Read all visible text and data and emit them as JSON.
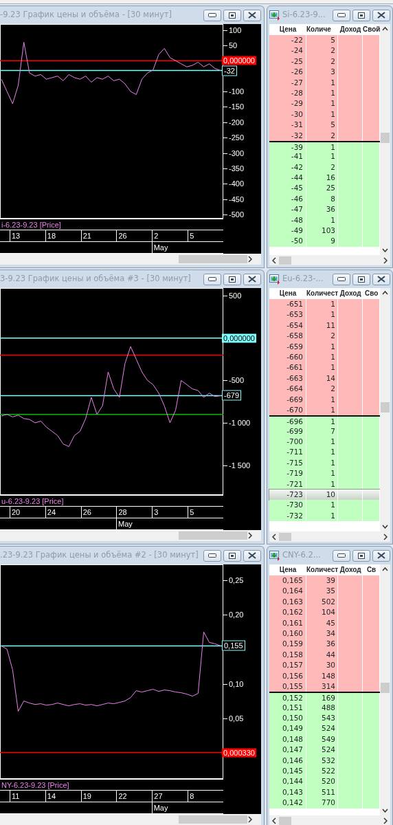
{
  "rows": [
    {
      "chart": {
        "title": "-9.23 График цены и объёма - [30 минут]",
        "chart_data": {
          "type": "line",
          "ylim": [
            -513,
            119
          ],
          "yticks": [
            {
              "value": 100,
              "label": "100"
            },
            {
              "value": 50,
              "label": "50"
            },
            {
              "value": -100,
              "label": "-100"
            },
            {
              "value": -150,
              "label": "-150"
            },
            {
              "value": -200,
              "label": "-200"
            },
            {
              "value": -250,
              "label": "-250"
            },
            {
              "value": -300,
              "label": "-300"
            },
            {
              "value": -350,
              "label": "-350"
            },
            {
              "value": -400,
              "label": "-400"
            },
            {
              "value": -450,
              "label": "-450"
            },
            {
              "value": -500,
              "label": "-500"
            }
          ],
          "series": [
            {
              "name": "i-6.23-9.23 [Price]",
              "color": "#ee82ee",
              "values": [
                -60,
                -100,
                -140,
                -80,
                60,
                -40,
                -50,
                -45,
                -60,
                -55,
                -50,
                -65,
                -45,
                -55,
                -60,
                -50,
                -70,
                -55,
                -60,
                -50,
                -65,
                -60,
                -75,
                -100,
                -110,
                -60,
                -40,
                -30,
                20,
                40,
                10,
                0,
                -10,
                -20,
                -15,
                -5,
                -20,
                -10,
                -25,
                -32
              ]
            }
          ],
          "ref_lines": [
            {
              "axis": "y",
              "value": 0,
              "label": "0,000000",
              "color": "#ff0000"
            },
            {
              "axis": "y",
              "value": -32,
              "label": "-32",
              "color": "#80ffff"
            }
          ]
        },
        "dates": [
          {
            "label": "13"
          },
          {
            "label": "18"
          },
          {
            "label": "21"
          },
          {
            "label": "26"
          },
          {
            "label": "2",
            "month": "May"
          },
          {
            "label": "5"
          }
        ]
      },
      "book": {
        "title": "Si-6.23-9...",
        "columns": [
          "Цена",
          "Количе",
          "Доход",
          "Свой"
        ],
        "rows": [
          {
            "kind": "ask",
            "price": "-22",
            "qty": "5",
            "selected": false
          },
          {
            "kind": "ask",
            "price": "-24",
            "qty": "2",
            "selected": false
          },
          {
            "kind": "ask",
            "price": "-25",
            "qty": "2",
            "selected": false
          },
          {
            "kind": "ask",
            "price": "-26",
            "qty": "3",
            "selected": false
          },
          {
            "kind": "ask",
            "price": "-27",
            "qty": "1",
            "selected": false
          },
          {
            "kind": "ask",
            "price": "-28",
            "qty": "1",
            "selected": false
          },
          {
            "kind": "ask",
            "price": "-29",
            "qty": "1",
            "selected": false
          },
          {
            "kind": "ask",
            "price": "-30",
            "qty": "1",
            "selected": false
          },
          {
            "kind": "ask",
            "price": "-31",
            "qty": "5",
            "selected": false
          },
          {
            "kind": "ask",
            "price": "-32",
            "qty": "2",
            "selected": false
          },
          {
            "kind": "bid",
            "price": "-39",
            "qty": "1",
            "selected": false
          },
          {
            "kind": "bid",
            "price": "-41",
            "qty": "1",
            "selected": false
          },
          {
            "kind": "bid",
            "price": "-42",
            "qty": "2",
            "selected": false
          },
          {
            "kind": "bid",
            "price": "-44",
            "qty": "16",
            "selected": false
          },
          {
            "kind": "bid",
            "price": "-45",
            "qty": "25",
            "selected": false
          },
          {
            "kind": "bid",
            "price": "-46",
            "qty": "8",
            "selected": false
          },
          {
            "kind": "bid",
            "price": "-47",
            "qty": "36",
            "selected": false
          },
          {
            "kind": "bid",
            "price": "-48",
            "qty": "1",
            "selected": false
          },
          {
            "kind": "bid",
            "price": "-49",
            "qty": "103",
            "selected": false
          },
          {
            "kind": "bid",
            "price": "-50",
            "qty": "9",
            "selected": false
          }
        ]
      }
    },
    {
      "chart": {
        "title": "3-9.23 График цены и объёма #3 - [30 минут]",
        "chart_data": {
          "type": "line",
          "ylim": [
            -1852,
            590
          ],
          "yticks": [
            {
              "value": 500,
              "label": "500"
            },
            {
              "value": -500,
              "label": "-500"
            },
            {
              "value": -1000,
              "label": "-1 000"
            },
            {
              "value": -1500,
              "label": "-1 500"
            }
          ],
          "series": [
            {
              "name": "u-6.23-9.23 [Price]",
              "color": "#ee82ee",
              "values": [
                -920,
                -900,
                -930,
                -910,
                -950,
                -960,
                -1000,
                -980,
                -1050,
                -1100,
                -1150,
                -1250,
                -1280,
                -1150,
                -1100,
                -950,
                -700,
                -900,
                -800,
                -400,
                -600,
                -700,
                -300,
                -100,
                -250,
                -400,
                -500,
                -550,
                -650,
                -800,
                -1000,
                -850,
                -500,
                -550,
                -600,
                -620,
                -700,
                -650,
                -690,
                -679
              ]
            }
          ],
          "ref_lines": [
            {
              "axis": "y",
              "value": 0,
              "label": "0,000000",
              "color": "#80ffff"
            },
            {
              "axis": "y",
              "value": -200,
              "color": "#ff0000"
            },
            {
              "axis": "y",
              "value": -679,
              "label": "-679",
              "color": "#80ffff"
            },
            {
              "axis": "y",
              "value": -900,
              "color": "#00c000"
            }
          ]
        },
        "dates": [
          {
            "label": "20"
          },
          {
            "label": "24"
          },
          {
            "label": "26"
          },
          {
            "label": "28",
            "month": "May"
          },
          {
            "label": "3"
          },
          {
            "label": "5"
          }
        ]
      },
      "book": {
        "title": "Eu-6.23-...",
        "columns": [
          "Цена",
          "Количест",
          "Доход",
          "Сво"
        ],
        "rows": [
          {
            "kind": "ask",
            "price": "-651",
            "qty": "1",
            "selected": false
          },
          {
            "kind": "ask",
            "price": "-653",
            "qty": "1",
            "selected": false
          },
          {
            "kind": "ask",
            "price": "-654",
            "qty": "11",
            "selected": false
          },
          {
            "kind": "ask",
            "price": "-658",
            "qty": "2",
            "selected": false
          },
          {
            "kind": "ask",
            "price": "-659",
            "qty": "1",
            "selected": false
          },
          {
            "kind": "ask",
            "price": "-660",
            "qty": "1",
            "selected": false
          },
          {
            "kind": "ask",
            "price": "-661",
            "qty": "1",
            "selected": false
          },
          {
            "kind": "ask",
            "price": "-663",
            "qty": "14",
            "selected": false
          },
          {
            "kind": "ask",
            "price": "-664",
            "qty": "2",
            "selected": false
          },
          {
            "kind": "ask",
            "price": "-669",
            "qty": "1",
            "selected": false
          },
          {
            "kind": "ask",
            "price": "-670",
            "qty": "1",
            "selected": false
          },
          {
            "kind": "bid",
            "price": "-696",
            "qty": "1",
            "selected": false
          },
          {
            "kind": "bid",
            "price": "-699",
            "qty": "7",
            "selected": false
          },
          {
            "kind": "bid",
            "price": "-700",
            "qty": "1",
            "selected": false
          },
          {
            "kind": "bid",
            "price": "-711",
            "qty": "1",
            "selected": false
          },
          {
            "kind": "bid",
            "price": "-715",
            "qty": "1",
            "selected": false
          },
          {
            "kind": "bid",
            "price": "-719",
            "qty": "1",
            "selected": false
          },
          {
            "kind": "bid",
            "price": "-721",
            "qty": "1",
            "selected": false
          },
          {
            "kind": "bid",
            "price": "-723",
            "qty": "10",
            "selected": true
          },
          {
            "kind": "bid",
            "price": "-730",
            "qty": "1",
            "selected": false
          },
          {
            "kind": "bid",
            "price": "-732",
            "qty": "1",
            "selected": false
          }
        ]
      }
    },
    {
      "chart": {
        "title": ".23-9.23 График цены и объёма #2 - [30 минут]",
        "chart_data": {
          "type": "line",
          "ylim": [
            -0.038,
            0.273
          ],
          "yticks": [
            {
              "value": 0.25,
              "label": "0,25"
            },
            {
              "value": 0.2,
              "label": "0,20"
            },
            {
              "value": 0.1,
              "label": "0,10"
            },
            {
              "value": 0.05,
              "label": "0,05"
            }
          ],
          "series": [
            {
              "name": "NY-6.23-9.23 [Price]",
              "color": "#ee82ee",
              "values": [
                0.155,
                0.15,
                0.12,
                0.06,
                0.075,
                0.072,
                0.07,
                0.071,
                0.069,
                0.07,
                0.072,
                0.07,
                0.068,
                0.07,
                0.071,
                0.069,
                0.07,
                0.068,
                0.07,
                0.072,
                0.071,
                0.073,
                0.075,
                0.08,
                0.09,
                0.088,
                0.09,
                0.092,
                0.089,
                0.091,
                0.09,
                0.088,
                0.087,
                0.085,
                0.082,
                0.086,
                0.175,
                0.16,
                0.158,
                0.155
              ]
            }
          ],
          "ref_lines": [
            {
              "axis": "y",
              "value": 0.155,
              "label": "0,155",
              "color": "#80ffff"
            },
            {
              "axis": "y",
              "value": 0.00033,
              "label": "0,000330",
              "color": "#ff0000"
            }
          ]
        },
        "dates": [
          {
            "label": "11"
          },
          {
            "label": "14"
          },
          {
            "label": "19"
          },
          {
            "label": "22"
          },
          {
            "label": "27",
            "month": "May"
          },
          {
            "label": "8"
          }
        ]
      },
      "book": {
        "title": "CNY-6.2...",
        "columns": [
          "Цена",
          "Количест",
          "Доход",
          "Св"
        ],
        "rows": [
          {
            "kind": "ask",
            "price": "0,165",
            "qty": "39",
            "selected": false
          },
          {
            "kind": "ask",
            "price": "0,164",
            "qty": "35",
            "selected": false
          },
          {
            "kind": "ask",
            "price": "0,163",
            "qty": "502",
            "selected": false
          },
          {
            "kind": "ask",
            "price": "0,162",
            "qty": "104",
            "selected": false
          },
          {
            "kind": "ask",
            "price": "0,161",
            "qty": "45",
            "selected": false
          },
          {
            "kind": "ask",
            "price": "0,160",
            "qty": "34",
            "selected": false
          },
          {
            "kind": "ask",
            "price": "0,159",
            "qty": "36",
            "selected": false
          },
          {
            "kind": "ask",
            "price": "0,158",
            "qty": "44",
            "selected": false
          },
          {
            "kind": "ask",
            "price": "0,157",
            "qty": "30",
            "selected": false
          },
          {
            "kind": "ask",
            "price": "0,156",
            "qty": "148",
            "selected": false
          },
          {
            "kind": "ask",
            "price": "0,155",
            "qty": "314",
            "selected": false
          },
          {
            "kind": "bid",
            "price": "0,152",
            "qty": "169",
            "selected": false
          },
          {
            "kind": "bid",
            "price": "0,151",
            "qty": "488",
            "selected": false
          },
          {
            "kind": "bid",
            "price": "0,150",
            "qty": "543",
            "selected": false
          },
          {
            "kind": "bid",
            "price": "0,149",
            "qty": "524",
            "selected": false
          },
          {
            "kind": "bid",
            "price": "0,148",
            "qty": "549",
            "selected": false
          },
          {
            "kind": "bid",
            "price": "0,147",
            "qty": "524",
            "selected": false
          },
          {
            "kind": "bid",
            "price": "0,146",
            "qty": "532",
            "selected": false
          },
          {
            "kind": "bid",
            "price": "0,145",
            "qty": "522",
            "selected": false
          },
          {
            "kind": "bid",
            "price": "0,144",
            "qty": "520",
            "selected": false
          },
          {
            "kind": "bid",
            "price": "0,143",
            "qty": "511",
            "selected": false
          },
          {
            "kind": "bid",
            "price": "0,142",
            "qty": "770",
            "selected": false
          }
        ]
      }
    }
  ]
}
